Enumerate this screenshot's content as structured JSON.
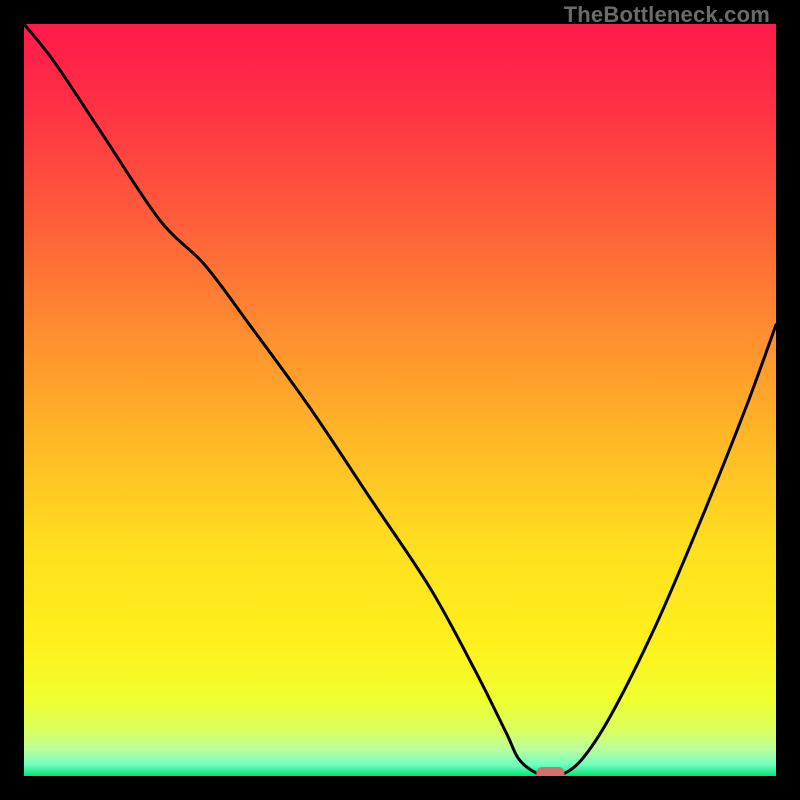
{
  "watermark": "TheBottleneck.com",
  "chart_data": {
    "type": "line",
    "title": "",
    "xlabel": "",
    "ylabel": "",
    "xlim": [
      0,
      100
    ],
    "ylim": [
      0,
      100
    ],
    "grid": false,
    "series": [
      {
        "name": "curve",
        "x": [
          0,
          4,
          10,
          18,
          24,
          30,
          38,
          46,
          54,
          60,
          64,
          66,
          69,
          71,
          74,
          78,
          84,
          90,
          96,
          100
        ],
        "y": [
          100,
          95,
          86,
          74,
          68,
          60,
          49,
          37,
          25,
          14,
          6,
          2,
          0,
          0,
          2,
          8,
          20,
          34,
          49,
          60
        ]
      }
    ],
    "marker": {
      "x": 70,
      "y": 0,
      "color": "#d6706f"
    },
    "gradient_stops": [
      {
        "offset": 0.0,
        "color": "#ff1a4b"
      },
      {
        "offset": 0.1,
        "color": "#ff2e45"
      },
      {
        "offset": 0.25,
        "color": "#ff5a3b"
      },
      {
        "offset": 0.4,
        "color": "#ff8a30"
      },
      {
        "offset": 0.55,
        "color": "#ffb727"
      },
      {
        "offset": 0.7,
        "color": "#ffe01f"
      },
      {
        "offset": 0.82,
        "color": "#fff01c"
      },
      {
        "offset": 0.9,
        "color": "#f0ff30"
      },
      {
        "offset": 0.94,
        "color": "#d8ff60"
      },
      {
        "offset": 0.965,
        "color": "#b8ffa0"
      },
      {
        "offset": 0.985,
        "color": "#70ffc0"
      },
      {
        "offset": 1.0,
        "color": "#00e676"
      }
    ]
  }
}
